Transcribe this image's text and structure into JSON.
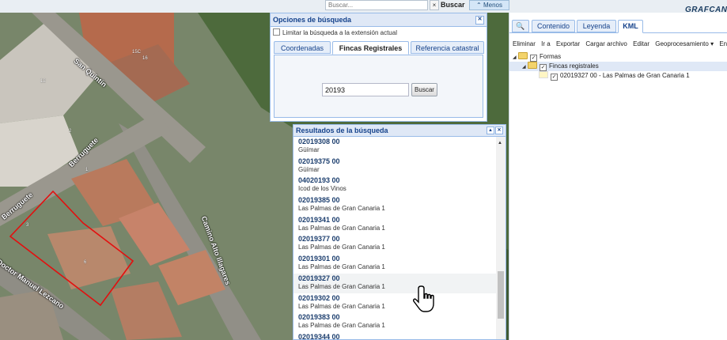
{
  "topbar": {
    "search_placeholder": "Buscar...",
    "clear_label": "×",
    "search_label": "Buscar",
    "less_label": "⌃ Menos",
    "logo": "GRAFCAN"
  },
  "map": {
    "streets": [
      "San Quintín",
      "Berruguete",
      "Berruguete",
      "Camino Alto Illagares",
      "Doctor Manuel Lezcano"
    ],
    "house_numbers": [
      "15C",
      "16",
      "12",
      "2",
      "1",
      "3",
      "6"
    ]
  },
  "search_options": {
    "title": "Opciones de búsqueda",
    "limit_label": "Limitar la búsqueda a la extensión actual",
    "tabs": [
      "Coordenadas",
      "Fincas Registrales",
      "Referencia catastral"
    ],
    "input_value": "20193",
    "button_label": "Buscar"
  },
  "results": {
    "title": "Resultados de la búsqueda",
    "items": [
      {
        "code": "02019308 00",
        "place": "Güímar"
      },
      {
        "code": "02019375 00",
        "place": "Güímar"
      },
      {
        "code": "04020193 00",
        "place": "Icod de los Vinos"
      },
      {
        "code": "02019385 00",
        "place": "Las Palmas de Gran Canaria 1"
      },
      {
        "code": "02019341 00",
        "place": "Las Palmas de Gran Canaria 1"
      },
      {
        "code": "02019377 00",
        "place": "Las Palmas de Gran Canaria 1"
      },
      {
        "code": "02019301 00",
        "place": "Las Palmas de Gran Canaria 1"
      },
      {
        "code": "02019327 00",
        "place": "Las Palmas de Gran Canaria 1"
      },
      {
        "code": "02019302 00",
        "place": "Las Palmas de Gran Canaria 1"
      },
      {
        "code": "02019383 00",
        "place": "Las Palmas de Gran Canaria 1"
      },
      {
        "code": "02019344 00",
        "place": ""
      }
    ]
  },
  "right_panel": {
    "search_tab": "🔍",
    "tabs": [
      "Contenido",
      "Leyenda",
      "KML"
    ],
    "toolbar": [
      "Eliminar",
      "Ir a",
      "Exportar",
      "Cargar archivo",
      "Editar",
      "Geoprocesamiento ▾",
      "Envi"
    ],
    "tree": {
      "root": "Formas",
      "folder": "Fincas registrales",
      "leaf": "02019327 00 - Las Palmas de Gran Canaria 1"
    }
  }
}
